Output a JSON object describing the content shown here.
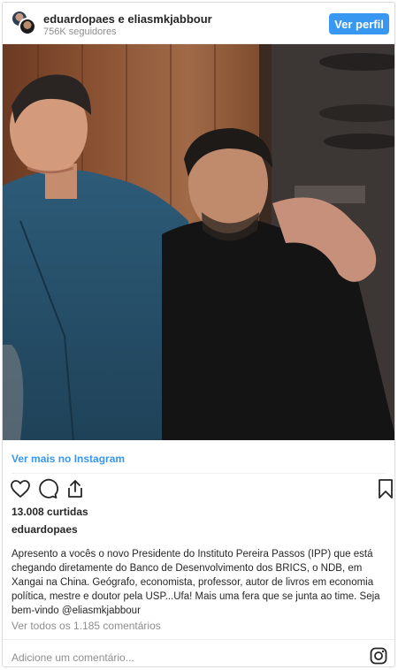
{
  "header": {
    "names": "eduardopaes e eliasmkjabbour",
    "followers": "756K seguidores",
    "follow_button": "Ver perfil"
  },
  "post": {
    "view_more": "Ver mais no Instagram",
    "likes": "13.008 curtidas",
    "author": "eduardopaes",
    "caption": "Apresento a vocês o novo Presidente do Instituto Pereira Passos (IPP) que está chegando diretamente do Banco de Desenvolvimento dos BRICS, o NDB, em Xangai na China. Geógrafo, economista, professor, autor de livros em economia política, mestre e doutor pela USP...Ufa! Mais uma fera que se junta ao time. Seja bem-vindo ",
    "mention": "@eliasmkjabbour",
    "comments_link": "Ver todos os 1.185 comentários",
    "add_comment_placeholder": "Adicione um comentário..."
  },
  "icons": {
    "like": "heart-icon",
    "comment": "comment-icon",
    "share": "share-icon",
    "save": "bookmark-icon",
    "brand": "instagram-icon"
  },
  "colors": {
    "accent": "#3897f0",
    "text": "#262626",
    "muted": "#8e8e8e",
    "border": "#dbdbdb"
  }
}
